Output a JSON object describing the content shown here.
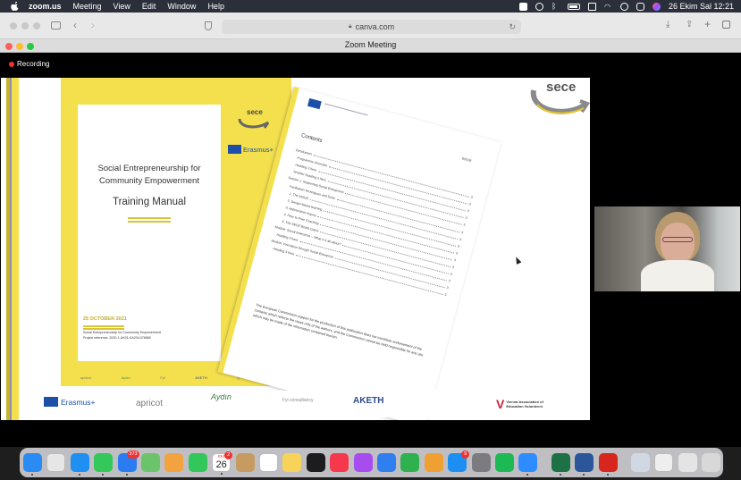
{
  "menubar": {
    "app_name": "zoom.us",
    "items": [
      "Meeting",
      "View",
      "Edit",
      "Window",
      "Help"
    ],
    "clock": "26 Ekim Sal  12:21"
  },
  "browser": {
    "url": "canva.com"
  },
  "zoom": {
    "window_title": "Zoom Meeting",
    "recording_label": "Recording"
  },
  "shared_document": {
    "cover": {
      "logo_text": "sece",
      "erasmus_label": "Erasmus+",
      "title_line1": "Social Entrepreneurship for",
      "title_line2": "Community Empowerment",
      "subtitle": "Training Manual",
      "date": "25 OCTOBER 2021",
      "project_line1": "Social Entrepreneurship for Community Empowerment",
      "project_line2": "Project reference: 2020-1-UK01-KA204-078880"
    },
    "contents_page": {
      "heading": "Contents",
      "entries": [
        {
          "label": "Introduction",
          "page": "3"
        },
        {
          "label": "Programme Overview",
          "page": "3"
        },
        {
          "label": "Heading 3 here",
          "page": "3"
        },
        {
          "label": "Another heading 3 here",
          "page": "3"
        },
        {
          "label": "Section 1: Supporting Social Enterprises",
          "page": "3"
        },
        {
          "label": "Facilitation Techniques and Tools",
          "page": "3"
        },
        {
          "label": "1.   The MOOC",
          "page": "3"
        },
        {
          "label": "2.   Design-based learning",
          "page": "3"
        },
        {
          "label": "3.   Appreciative Inquiry",
          "page": "3"
        },
        {
          "label": "4.   Peer to Peer Coaching",
          "page": "3"
        },
        {
          "label": "5.   The SECE Board Game",
          "page": "3"
        },
        {
          "label": "Module: Social Enterprise – What is it all about?",
          "page": "3"
        },
        {
          "label": "Heading 3 here",
          "page": "3"
        },
        {
          "label": "Module: Innovation through Social Enterprise",
          "page": "3"
        },
        {
          "label": "Heading 3 here",
          "page": "3"
        }
      ],
      "disclaimer": "The European Commission support for the production of this publication does not constitute endorsement of the contents which reflects the views only of the authors, and the Commission cannot be held responsible for any use which may be made of the information contained therein."
    },
    "partner_logos": [
      "Erasmus+",
      "apricot",
      "Aydın",
      "Fyi consultancy",
      "AKETH",
      "Vienna Association of Education Volunteers"
    ]
  },
  "dock": {
    "apps": [
      {
        "name": "Finder",
        "color": "#2a8bf2",
        "running": true
      },
      {
        "name": "Launchpad",
        "color": "#e6e6e6",
        "running": false
      },
      {
        "name": "Safari",
        "color": "#1f8ff2",
        "running": true
      },
      {
        "name": "Messages",
        "color": "#34c759",
        "running": true
      },
      {
        "name": "Mail",
        "color": "#2a7cf0",
        "running": true,
        "badge": "373"
      },
      {
        "name": "Maps",
        "color": "#6bc36a",
        "running": false
      },
      {
        "name": "Photos",
        "color": "#f2a340",
        "running": false
      },
      {
        "name": "FaceTime",
        "color": "#31c75a",
        "running": false
      },
      {
        "name": "Calendar",
        "color": "#ffffff",
        "running": true,
        "badge": "2",
        "month": "EKİ",
        "day": "26"
      },
      {
        "name": "Contacts",
        "color": "#c59b62",
        "running": false
      },
      {
        "name": "Reminders",
        "color": "#ffffff",
        "running": false
      },
      {
        "name": "Notes",
        "color": "#f7d35a",
        "running": false
      },
      {
        "name": "TV",
        "color": "#1c1c1e",
        "running": false
      },
      {
        "name": "Music",
        "color": "#f6384c",
        "running": false
      },
      {
        "name": "Podcasts",
        "color": "#a74df0",
        "running": false
      },
      {
        "name": "Keynote",
        "color": "#2f7ff0",
        "running": false
      },
      {
        "name": "Numbers",
        "color": "#2fb14f",
        "running": false
      },
      {
        "name": "Pages",
        "color": "#f0a032",
        "running": false
      },
      {
        "name": "App Store",
        "color": "#1d8ef2",
        "running": false,
        "badge": "9"
      },
      {
        "name": "System Preferences",
        "color": "#7b7b80",
        "running": false
      },
      {
        "name": "Spotify",
        "color": "#1db954",
        "running": false
      },
      {
        "name": "Zoom",
        "color": "#2d8cff",
        "running": true
      },
      {
        "name": "Excel",
        "color": "#1e7145",
        "running": true
      },
      {
        "name": "Word",
        "color": "#2b579a",
        "running": true
      },
      {
        "name": "Acrobat",
        "color": "#d7261e",
        "running": true
      },
      {
        "name": "Downloads",
        "color": "#cfd8e3",
        "running": false
      },
      {
        "name": "Documents",
        "color": "#eeeeee",
        "running": false
      },
      {
        "name": "Recent",
        "color": "#e4e4e4",
        "running": false
      },
      {
        "name": "Trash",
        "color": "#d8d8d8",
        "running": false
      }
    ]
  }
}
